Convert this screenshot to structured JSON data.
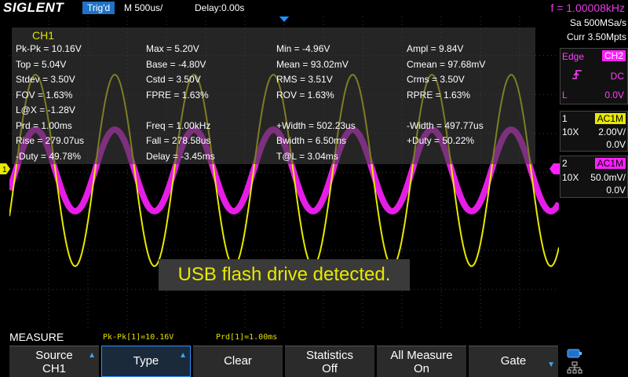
{
  "topbar": {
    "brand": "SIGLENT",
    "trigger_status": "Trig'd",
    "timebase": "M 500us/",
    "delay": "Delay:0.00s",
    "frequency": "f = 1.00008kHz"
  },
  "acquisition": {
    "sample_rate": "Sa 500MSa/s",
    "memory_depth": "Curr 3.50Mpts"
  },
  "trigger": {
    "type_label": "Edge",
    "source": "CH2",
    "coupling": "DC",
    "level_marker": "L",
    "level": "0.0V"
  },
  "channels": [
    {
      "number": "1",
      "coupling": "AC1M",
      "probe": "10X",
      "scale": "2.00V/",
      "offset": "0.0V",
      "color": "#e8e800",
      "marker": "1"
    },
    {
      "number": "2",
      "coupling": "AC1M",
      "probe": "10X",
      "scale": "50.0mV/",
      "offset": "0.0V",
      "color": "#ff20ff",
      "marker": "2"
    }
  ],
  "measurements": {
    "channel": "CH1",
    "rows": [
      [
        "Pk-Pk = 10.16V",
        "Max = 5.20V",
        "Min = -4.96V",
        "Ampl = 9.84V"
      ],
      [
        "Top = 5.04V",
        "Base = -4.80V",
        "Mean = 93.02mV",
        "Cmean = 97.68mV"
      ],
      [
        "Stdev = 3.50V",
        "Cstd = 3.50V",
        "RMS = 3.51V",
        "Crms = 3.50V"
      ],
      [
        "FOV = 1.63%",
        "FPRE = 1.63%",
        "ROV = 1.63%",
        "RPRE = 1.63%"
      ],
      [
        "L@X = -1.28V",
        "",
        "",
        ""
      ],
      [
        "Prd = 1.00ms",
        "Freq = 1.00kHz",
        "+Width = 502.23us",
        "-Width = 497.77us"
      ],
      [
        "Rise = 279.07us",
        "Fall = 278.58us",
        "Bwidth = 6.50ms",
        "+Duty = 50.22%"
      ],
      [
        "-Duty = 49.78%",
        "Delay = -3.45ms",
        "T@L = 3.04ms",
        ""
      ]
    ]
  },
  "toast": "USB flash drive detected.",
  "bottom": {
    "menu_title": "MEASURE",
    "stat1": "Pk-Pk[1]=10.16V",
    "stat2": "Prd[1]=1.00ms",
    "softkeys": {
      "source_l1": "Source",
      "source_l2": "CH1",
      "type": "Type",
      "clear": "Clear",
      "statistics_l1": "Statistics",
      "statistics_l2": "Off",
      "allmeasure_l1": "All Measure",
      "allmeasure_l2": "On",
      "gate": "Gate"
    }
  }
}
